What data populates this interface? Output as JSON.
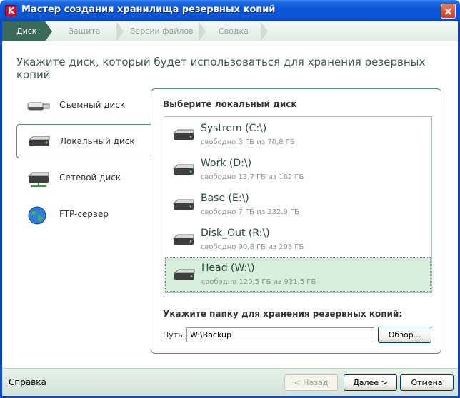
{
  "window": {
    "title": "Мастер создания хранилища резервных копий"
  },
  "steps": [
    {
      "label": "Диск",
      "active": true
    },
    {
      "label": "Защита",
      "active": false
    },
    {
      "label": "Версии файлов",
      "active": false
    },
    {
      "label": "Сводка",
      "active": false
    }
  ],
  "page_title": "Укажите диск, который будет использоваться для хранения резервных копий",
  "nav": [
    {
      "label": "Съемный диск",
      "icon": "usb-drive-icon"
    },
    {
      "label": "Локальный диск",
      "icon": "hard-drive-icon",
      "selected": true
    },
    {
      "label": "Сетевой диск",
      "icon": "network-drive-icon"
    },
    {
      "label": "FTP-сервер",
      "icon": "globe-icon"
    }
  ],
  "panel": {
    "heading": "Выберите локальный диск",
    "disks": [
      {
        "name": "Systrem (C:\\)",
        "free": "свободно 3 ГБ из 70,8 ГБ"
      },
      {
        "name": "Work (D:\\)",
        "free": "свободно 13,7 ГБ из 162 ГБ"
      },
      {
        "name": "Base (E:\\)",
        "free": "свободно 7 ГБ из 232,9 ГБ"
      },
      {
        "name": "Disk_Out (R:\\)",
        "free": "свободно 90,8 ГБ из 298 ГБ"
      },
      {
        "name": "Head (W:\\)",
        "free": "свободно 120,5 ГБ из 931,5 ГБ",
        "selected": true
      }
    ],
    "folder_heading": "Укажите папку для хранения резервных копий:",
    "path_label": "Путь:",
    "path_value": "W:\\Backup",
    "browse_label": "Обзор..."
  },
  "footer": {
    "help": "Справка",
    "back": "< Назад",
    "next": "Далее >",
    "cancel": "Отмена"
  },
  "colors": {
    "accent": "#3a6a59",
    "selected_row": "#d6eedc",
    "titlebar": "#0a54d6"
  }
}
